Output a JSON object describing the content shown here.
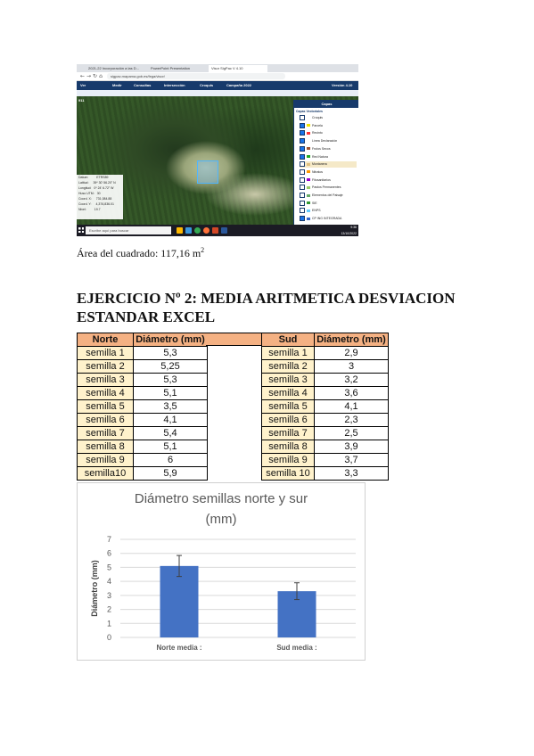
{
  "screenshot": {
    "tabs": [
      "2021-22 Incorporación a las D...",
      "PowerPoint Presentation",
      "Visor SigPac V 4.10"
    ],
    "url": "sigpac.mapama.gob.es/fega/visor/",
    "toolbar": [
      "Ver",
      "Medir",
      "Consultas",
      "Intersección",
      "Croquis",
      "Campaña 2022"
    ],
    "version": "Versión 4.10",
    "surface_label": "Superficie: 117.16 m²",
    "scale_label": "911",
    "coords": {
      "datum_label": "Datum:",
      "datum_value": "ETRS89",
      "lat_label": "Latitud:",
      "lat_value": "39º 30' 56.20\" N",
      "lon_label": "Longitud:",
      "lon_value": "0º 24' 6.72\" W",
      "huso_label": "Huso UTM:",
      "huso_value": "30",
      "x_label": "Coord. X:",
      "x_value": "731,084.88",
      "y_label": "Coord. Y:",
      "y_value": "4,376,836.01",
      "zoom_label": "Nivel:",
      "zoom_value": "19.7"
    },
    "layers_title": "Capas",
    "layers_group": "Capas Vectoriales",
    "layers": [
      {
        "name": "Croquis",
        "on": false,
        "swatch": "#ffffff"
      },
      {
        "name": "Parcela",
        "on": true,
        "swatch": "#f2e600"
      },
      {
        "name": "Recinto",
        "on": true,
        "swatch": "#ff3333"
      },
      {
        "name": "Línea Declaración",
        "on": true,
        "swatch": "#ffffff"
      },
      {
        "name": "Frutos Secos",
        "on": true,
        "swatch": "#a0522d"
      },
      {
        "name": "Red Natura",
        "on": true,
        "swatch": "#22aa22"
      },
      {
        "name": "Montanera",
        "on": false,
        "swatch": "#e0c080"
      },
      {
        "name": "Nitratos",
        "on": false,
        "swatch": "#ff9900"
      },
      {
        "name": "Fitosanitarios",
        "on": false,
        "swatch": "#9900cc"
      },
      {
        "name": "Pastos Permanentes",
        "on": false,
        "swatch": "#99cc66"
      },
      {
        "name": "Elementos del Paisaje",
        "on": false,
        "swatch": "#66aa66"
      },
      {
        "name": "SIE",
        "on": false,
        "swatch": "#339933"
      },
      {
        "name": "ENPS",
        "on": false,
        "swatch": "#66ccff"
      },
      {
        "name": "CP ING INTEGRADA",
        "on": true,
        "swatch": "#3366cc"
      }
    ],
    "taskbar_search": "Escribe aquí para buscar",
    "tray_time": "9:36",
    "tray_date": "13/10/2022"
  },
  "caption_prefix": "Área del cuadrado: 117,16 m",
  "caption_sup": "2",
  "heading": "EJERCICIO Nº 2: MEDIA ARITMETICA DESVIACION ESTANDAR EXCEL",
  "table_norte": {
    "headers": [
      "Norte",
      "Diámetro (mm)"
    ],
    "rows": [
      [
        "semilla 1",
        "5,3"
      ],
      [
        "semilla 2",
        "5,25"
      ],
      [
        "semilla 3",
        "5,3"
      ],
      [
        "semilla 4",
        "5,1"
      ],
      [
        "semilla 5",
        "3,5"
      ],
      [
        "semilla 6",
        "4,1"
      ],
      [
        "semilla 7",
        "5,4"
      ],
      [
        "semilla 8",
        "5,1"
      ],
      [
        "semilla 9",
        "6"
      ],
      [
        "semilla10",
        "5,9"
      ]
    ]
  },
  "table_sud": {
    "headers": [
      "Sud",
      "Diámetro (mm)"
    ],
    "rows": [
      [
        "semilla 1",
        "2,9"
      ],
      [
        "semilla 2",
        "3"
      ],
      [
        "semilla 3",
        "3,2"
      ],
      [
        "semilla 4",
        "3,6"
      ],
      [
        "semilla 5",
        "4,1"
      ],
      [
        "semilla 6",
        "2,3"
      ],
      [
        "semilla 7",
        "2,5"
      ],
      [
        "semilla 8",
        "3,9"
      ],
      [
        "semilla 9",
        "3,7"
      ],
      [
        "semilla 10",
        "3,3"
      ]
    ]
  },
  "chart_data": {
    "type": "bar",
    "title_line1": "Diámetro semillas norte y sur",
    "title_line2": "(mm)",
    "ylabel": "Diámetro (mm)",
    "xlabel": "",
    "categories": [
      "Norte media :",
      "Sud media :"
    ],
    "values": [
      5.1,
      3.3
    ],
    "error": [
      0.75,
      0.6
    ],
    "ylim": [
      0,
      7
    ],
    "yticks": [
      0,
      1,
      2,
      3,
      4,
      5,
      6,
      7
    ],
    "grid": true,
    "bar_color": "#4472c4"
  }
}
